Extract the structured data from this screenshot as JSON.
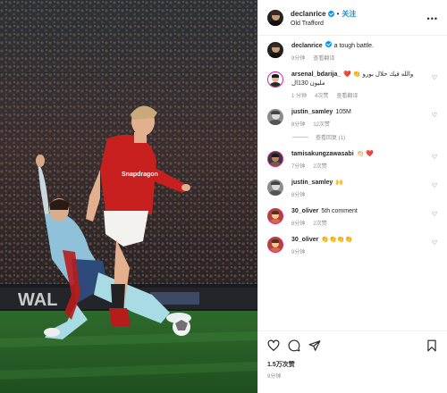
{
  "post": {
    "author": "declanrice",
    "follow_label": "关注",
    "dot": "•",
    "location": "Old Trafford",
    "caption": "a tough battle.",
    "caption_time": "9分钟",
    "caption_translate": "查看翻译"
  },
  "comments": [
    {
      "user": "arsenal_bdarija_",
      "text": "❤️ 👏 والله فيك حلال بورو مليون 130ال",
      "time": "1 分钟",
      "likes": "4次赞",
      "translate": "查看翻译"
    },
    {
      "user": "justin_samley",
      "text": "105M",
      "time": "8分钟",
      "likes": "12次赞",
      "view_replies": "查看回复 (1)"
    },
    {
      "user": "tamisakungzawasabi",
      "text": "👏🏻 ❤️",
      "time": "7分钟",
      "likes": "2次赞"
    },
    {
      "user": "justin_samley",
      "text": "🙌",
      "time": "8分钟"
    },
    {
      "user": "30_oliver",
      "text": "5th comment",
      "time": "8分钟",
      "likes": "2次赞"
    },
    {
      "user": "30_oliver",
      "text": "👏👏👏👏",
      "time": "9分钟"
    }
  ],
  "footer": {
    "likes": "1.5万次赞",
    "time": "9分钟"
  },
  "icons": {
    "heart": "heart-icon",
    "comment": "comment-icon",
    "share": "share-icon",
    "save": "bookmark-icon",
    "more": "more-icon"
  },
  "colors": {
    "link_blue": "#0095f6",
    "verified_blue": "#0095f6",
    "muted": "#8e8e8e"
  }
}
